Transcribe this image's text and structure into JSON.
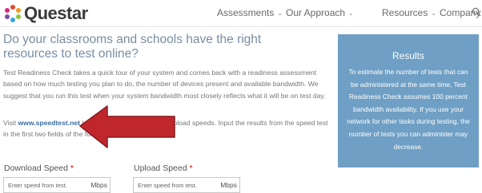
{
  "brand": {
    "name": "Questar"
  },
  "nav": {
    "items": [
      {
        "label": "Assessments"
      },
      {
        "label": "Our Approach"
      },
      {
        "label": "Resources"
      },
      {
        "label": "Company"
      }
    ]
  },
  "main": {
    "heading": "Do your classrooms and schools have the right resources to test online?",
    "paragraph1": "Test Readiness Check takes a quick tour of your system and comes back with a readiness assessment based on how much testing you plan to do, the number of devices present and available bandwidth. We suggest that you run this test when your system bandwidth most closely reflects what it will be on test day.",
    "paragraph2_prefix": "Visit ",
    "paragraph2_link": "www.speedtest.net",
    "paragraph2_suffix": " to check your download and upload speeds. Input the results from the speed test in the first two fields of the form below."
  },
  "results": {
    "title": "Results",
    "text": "To estimate the number of tests that can be administered at the same time, Test Readiness Check assumes 100 percent bandwidth availability. If you use your network for other tasks during testing, the number of tests you can administer may decrease."
  },
  "form": {
    "download": {
      "label": "Download Speed",
      "required_mark": "*",
      "placeholder": "Enter speed from test.",
      "unit": "Mbps"
    },
    "upload": {
      "label": "Upload Speed",
      "required_mark": "*",
      "placeholder": "Enter speed from test.",
      "unit": "Mbps"
    }
  },
  "colors": {
    "accent": "#7a8ea3",
    "results_bg": "#6f9fc4",
    "arrow": "#c0272d",
    "link": "#3a6ea5"
  },
  "icons": {
    "logo": "questar-logo-mark",
    "search": "search-icon",
    "chevron": "chevron-down-icon",
    "arrow": "red-arrow-annotation"
  }
}
